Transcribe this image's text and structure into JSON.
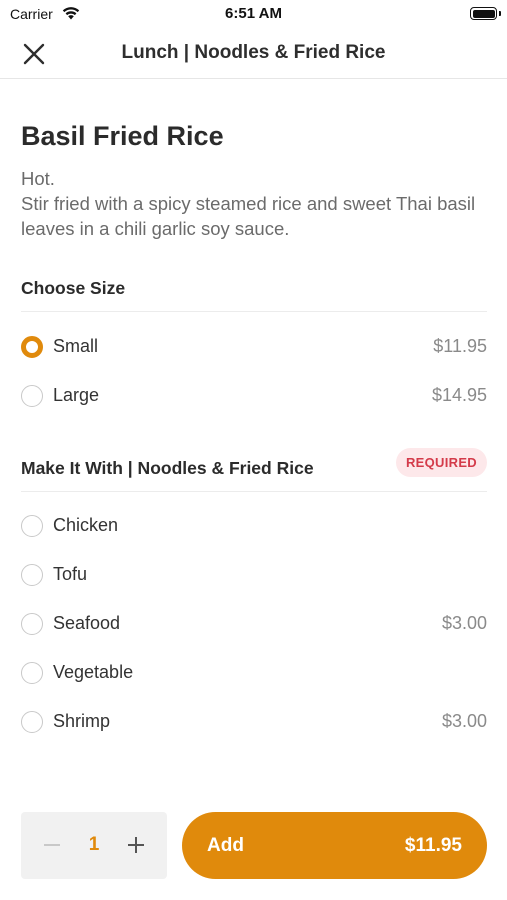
{
  "status_bar": {
    "carrier": "Carrier",
    "time": "6:51 AM"
  },
  "nav": {
    "title": "Lunch | Noodles & Fried Rice",
    "close_icon": "close-icon"
  },
  "item": {
    "name": "Basil Fried Rice",
    "description_line1": "Hot.",
    "description_line2": "Stir fried with a spicy steamed rice and sweet Thai basil leaves in a chili garlic soy sauce."
  },
  "sections": [
    {
      "title": "Choose Size",
      "required": false,
      "options": [
        {
          "label": "Small",
          "price": "$11.95",
          "selected": true
        },
        {
          "label": "Large",
          "price": "$14.95",
          "selected": false
        }
      ]
    },
    {
      "title": "Make It With | Noodles & Fried Rice",
      "required": true,
      "required_label": "REQUIRED",
      "options": [
        {
          "label": "Chicken",
          "price": "",
          "selected": false
        },
        {
          "label": "Tofu",
          "price": "",
          "selected": false
        },
        {
          "label": "Seafood",
          "price": "$3.00",
          "selected": false
        },
        {
          "label": "Vegetable",
          "price": "",
          "selected": false
        },
        {
          "label": "Shrimp",
          "price": "$3.00",
          "selected": false
        }
      ]
    }
  ],
  "footer": {
    "quantity": "1",
    "add_label": "Add",
    "add_price": "$11.95"
  },
  "colors": {
    "accent": "#e08a0c",
    "required_bg": "#fde8ea",
    "required_text": "#d43b4a"
  }
}
